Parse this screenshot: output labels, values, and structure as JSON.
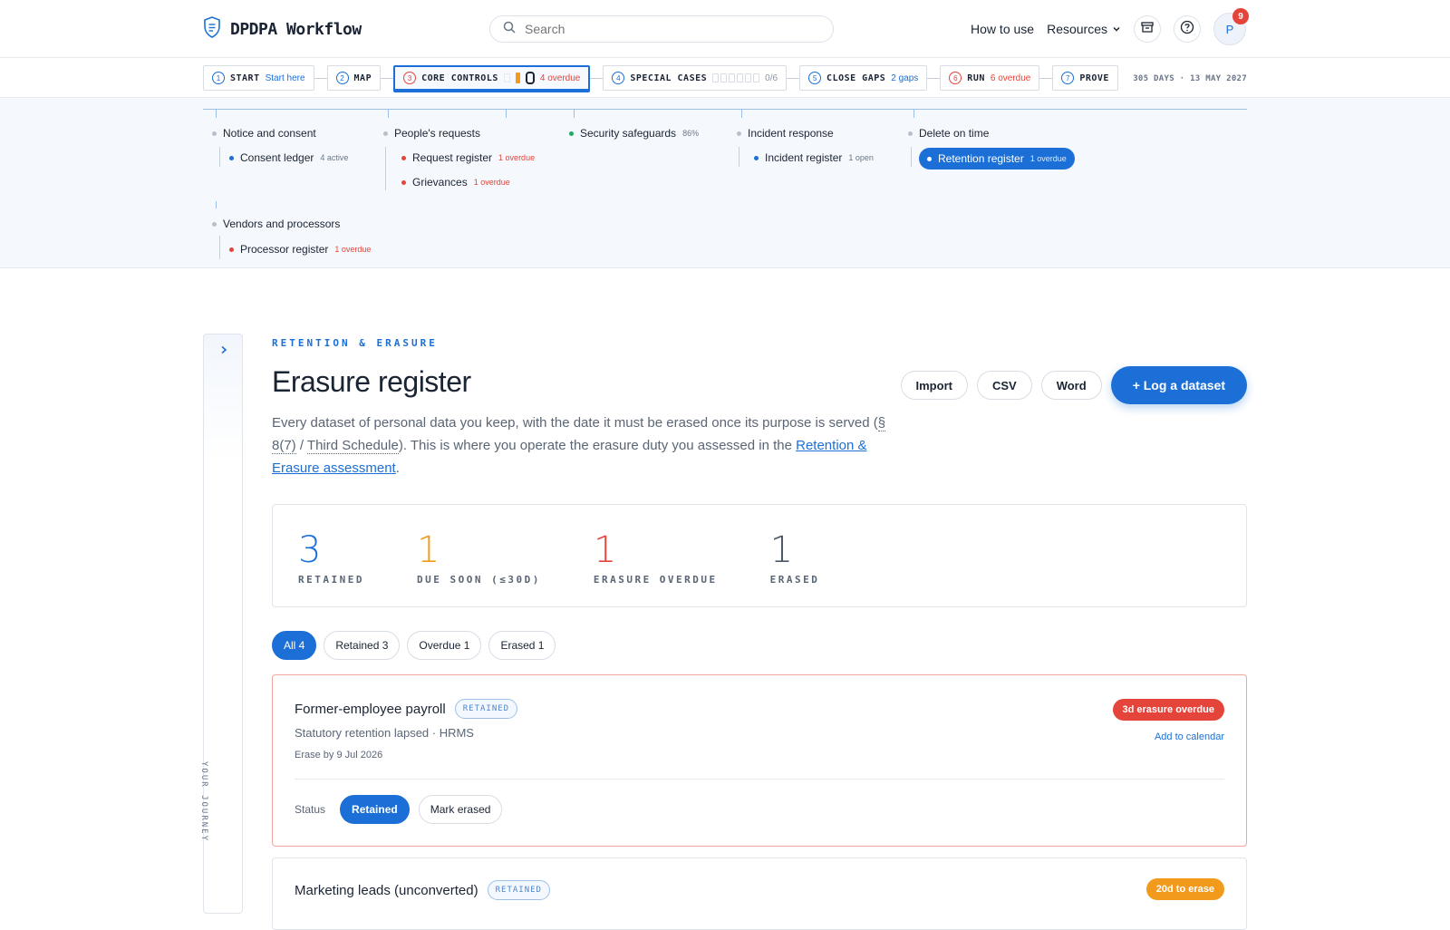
{
  "header": {
    "brand": "DPDPA Workflow",
    "search_placeholder": "Search",
    "how_to_use": "How to use",
    "resources": "Resources",
    "avatar_initial": "P",
    "notif_count": "9"
  },
  "steps": [
    {
      "num": "1",
      "label": "START",
      "sub": "Start here"
    },
    {
      "num": "2",
      "label": "MAP",
      "sub": ""
    },
    {
      "num": "3",
      "label": "CORE CONTROLS",
      "sub": "4 overdue"
    },
    {
      "num": "4",
      "label": "SPECIAL CASES",
      "sub": "0/6"
    },
    {
      "num": "5",
      "label": "CLOSE GAPS",
      "sub": "2 gaps"
    },
    {
      "num": "6",
      "label": "RUN",
      "sub": "6 overdue"
    },
    {
      "num": "7",
      "label": "PROVE",
      "sub": ""
    }
  ],
  "deadline": "305 DAYS · 13 MAY 2027",
  "tree": {
    "notice": "Notice and consent",
    "consent_ledger": "Consent ledger",
    "consent_meta": "4 active",
    "peoples": "People's requests",
    "request_register": "Request register",
    "request_meta": "1 overdue",
    "grievances": "Grievances",
    "grievances_meta": "1 overdue",
    "security": "Security safeguards",
    "security_meta": "86%",
    "incident": "Incident response",
    "incident_register": "Incident register",
    "incident_meta": "1 open",
    "delete": "Delete on time",
    "retention_register": "Retention register",
    "retention_meta": "1 overdue",
    "vendors": "Vendors and processors",
    "processor_register": "Processor register",
    "processor_meta": "1 overdue"
  },
  "sidebar": {
    "label": "YOUR JOURNEY"
  },
  "page": {
    "eyebrow": "RETENTION & ERASURE",
    "title": "Erasure register",
    "desc_a": "Every dataset of personal data you keep, with the date it must be erased once its purpose is served (",
    "desc_ref1": "§ 8(7)",
    "desc_sep": " / ",
    "desc_ref2": "Third Schedule",
    "desc_b": "). This is where you operate the erasure duty you assessed in the ",
    "desc_link": "Retention & Erasure assessment",
    "desc_c": "."
  },
  "actions": {
    "import": "Import",
    "csv": "CSV",
    "word": "Word",
    "log": "+ Log a dataset"
  },
  "stats": [
    {
      "value": "3",
      "label": "RETAINED",
      "color": "#1b6fd6"
    },
    {
      "value": "1",
      "label": "DUE SOON (≤30D)",
      "color": "#f29a1b"
    },
    {
      "value": "1",
      "label": "ERASURE OVERDUE",
      "color": "#e5443b"
    },
    {
      "value": "1",
      "label": "ERASED",
      "color": "#4a5566"
    }
  ],
  "filters": [
    {
      "label": "All 4"
    },
    {
      "label": "Retained 3"
    },
    {
      "label": "Overdue 1"
    },
    {
      "label": "Erased 1"
    }
  ],
  "datasets": [
    {
      "name": "Former-employee payroll",
      "tag": "RETAINED",
      "sub": "Statutory retention lapsed · HRMS",
      "erase": "Erase by 9 Jul 2026",
      "due": "3d erasure overdue",
      "calendar": "Add to calendar",
      "status_label": "Status",
      "retained_btn": "Retained",
      "erased_btn": "Mark erased"
    },
    {
      "name": "Marketing leads (unconverted)",
      "tag": "RETAINED",
      "due": "20d to erase"
    }
  ]
}
